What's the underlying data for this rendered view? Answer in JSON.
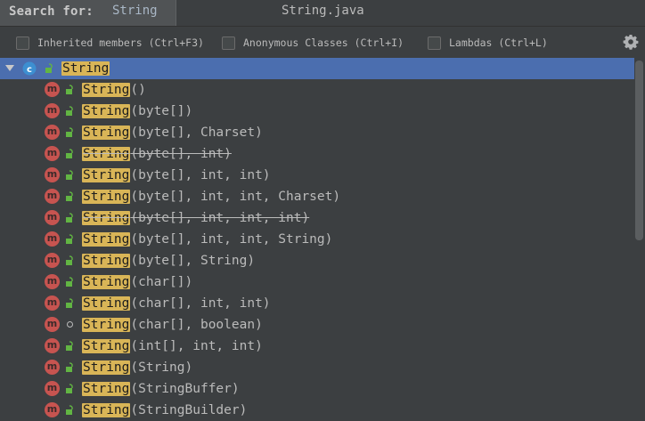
{
  "search": {
    "label": "Search for:",
    "value": "String"
  },
  "file_title": "String.java",
  "filters": [
    {
      "label": "Inherited members (Ctrl+F3)",
      "checked": false
    },
    {
      "label": "Anonymous Classes (Ctrl+I)",
      "checked": false
    },
    {
      "label": "Lambdas (Ctrl+L)",
      "checked": false
    }
  ],
  "settings_icon": "gear-icon",
  "tree": {
    "root": {
      "match": "String",
      "icon": "class-icon",
      "expanded": true,
      "selected": true
    },
    "items": [
      {
        "match": "String",
        "params": "()",
        "access": "public",
        "deprecated": false
      },
      {
        "match": "String",
        "params": "(byte[])",
        "access": "public",
        "deprecated": false
      },
      {
        "match": "String",
        "params": "(byte[], Charset)",
        "access": "public",
        "deprecated": false
      },
      {
        "match": "String",
        "params": "(byte[], int)",
        "access": "public",
        "deprecated": true
      },
      {
        "match": "String",
        "params": "(byte[], int, int)",
        "access": "public",
        "deprecated": false
      },
      {
        "match": "String",
        "params": "(byte[], int, int, Charset)",
        "access": "public",
        "deprecated": false
      },
      {
        "match": "String",
        "params": "(byte[], int, int, int)",
        "access": "public",
        "deprecated": true
      },
      {
        "match": "String",
        "params": "(byte[], int, int, String)",
        "access": "public",
        "deprecated": false
      },
      {
        "match": "String",
        "params": "(byte[], String)",
        "access": "public",
        "deprecated": false
      },
      {
        "match": "String",
        "params": "(char[])",
        "access": "public",
        "deprecated": false
      },
      {
        "match": "String",
        "params": "(char[], int, int)",
        "access": "public",
        "deprecated": false
      },
      {
        "match": "String",
        "params": "(char[], boolean)",
        "access": "package-private",
        "deprecated": false
      },
      {
        "match": "String",
        "params": "(int[], int, int)",
        "access": "public",
        "deprecated": false
      },
      {
        "match": "String",
        "params": "(String)",
        "access": "public",
        "deprecated": false
      },
      {
        "match": "String",
        "params": "(StringBuffer)",
        "access": "public",
        "deprecated": false
      },
      {
        "match": "String",
        "params": "(StringBuilder)",
        "access": "public",
        "deprecated": false
      }
    ]
  },
  "colors": {
    "background": "#3c3f41",
    "selection": "#4b6eaf",
    "search_highlight": "#d9b557",
    "method_icon": "#c75450",
    "class_icon": "#3d8fd1",
    "public_lock": "#62b543"
  }
}
